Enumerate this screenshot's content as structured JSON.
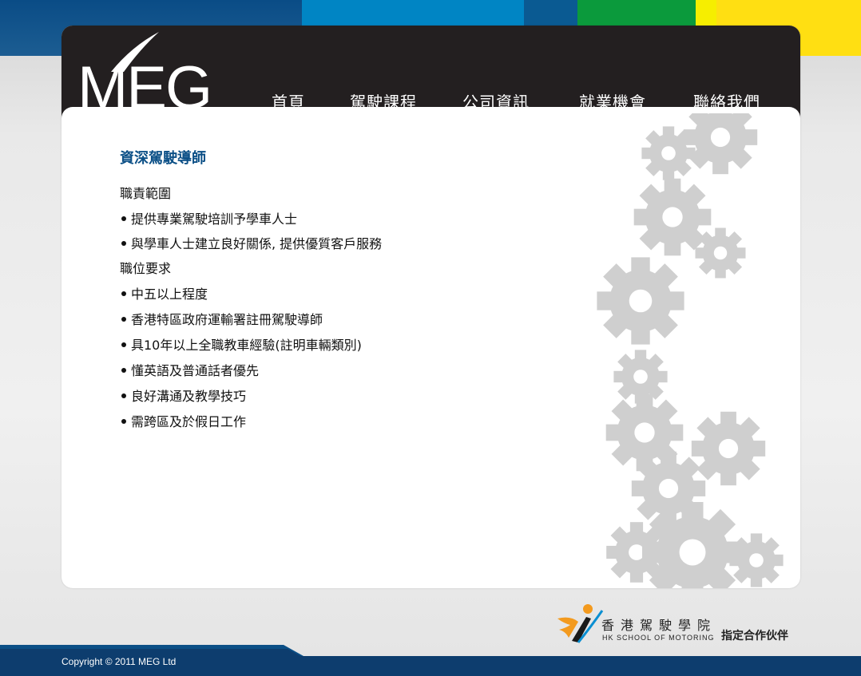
{
  "brand": {
    "logo_text": "MEG"
  },
  "nav": {
    "items": [
      {
        "label": "首頁"
      },
      {
        "label": "駕駛課程"
      },
      {
        "label": "公司資訊"
      },
      {
        "label": "就業機會"
      },
      {
        "label": "聯絡我們"
      }
    ]
  },
  "job": {
    "title": "資深駕駛導師",
    "responsibilities_heading": "職責範圍",
    "responsibilities": [
      "提供專業駕駛培訓予學車人士",
      "與學車人士建立良好關係, 提供優質客戶服務"
    ],
    "requirements_heading": "職位要求",
    "requirements": [
      "中五以上程度",
      "香港特區政府運輸署註冊駕駛導師",
      "具10年以上全職教車經驗(註明車輛類別)",
      "懂英語及普通話者優先",
      "良好溝通及教學技巧",
      "需跨區及於假日工作"
    ]
  },
  "partner": {
    "name_zh": "香港駕駛學院",
    "name_en": "HK SCHOOL OF MOTORING",
    "role": "指定合作伙伴"
  },
  "footer": {
    "copyright": "Copyright © 2011 MEG Ltd"
  },
  "colors": {
    "header_bg": "#231f20",
    "title_blue": "#0b4f86",
    "stripe_blue": "#0085c4",
    "stripe_green": "#0b9a3c",
    "stripe_yellow": "#ffe013",
    "footer_navy": "#0d3d6e",
    "gear_gray": "#cfcfcf"
  }
}
